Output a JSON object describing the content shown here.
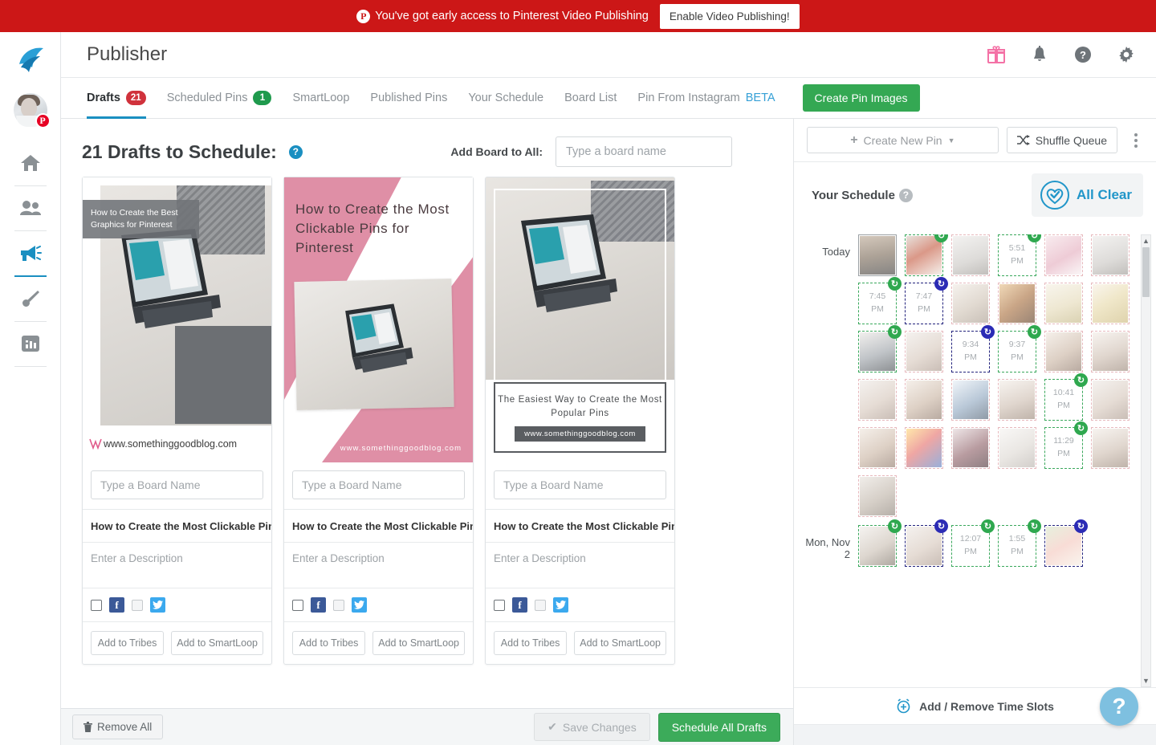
{
  "promo": {
    "icon": "pinterest-icon",
    "message": "You've got early access to Pinterest Video Publishing",
    "button_label": "Enable Video Publishing!",
    "background": "#cc1717"
  },
  "sidebar": {
    "logo": "tailwind-logo",
    "avatar": {
      "name": "user-avatar",
      "badge": "P"
    },
    "items": [
      {
        "name": "home-icon",
        "active": false
      },
      {
        "name": "tribes-people-icon",
        "active": false
      },
      {
        "name": "megaphone-publisher-icon",
        "active": true
      },
      {
        "name": "brush-create-icon",
        "active": false
      },
      {
        "name": "analytics-chart-icon",
        "active": false
      }
    ]
  },
  "header": {
    "title": "Publisher",
    "icons": [
      {
        "name": "gift-icon",
        "color": "#f472a6"
      },
      {
        "name": "bell-icon",
        "color": "#6e7479"
      },
      {
        "name": "help-circle-icon",
        "color": "#6e7479"
      },
      {
        "name": "gear-icon",
        "color": "#6e7479"
      }
    ]
  },
  "tabs": {
    "items": [
      {
        "label": "Drafts",
        "count": "21",
        "count_color": "#d0323c",
        "active": true
      },
      {
        "label": "Scheduled Pins",
        "count": "1",
        "count_color": "#1f9a4d",
        "active": false
      },
      {
        "label": "SmartLoop",
        "active": false
      },
      {
        "label": "Published Pins",
        "active": false
      },
      {
        "label": "Your Schedule",
        "active": false
      },
      {
        "label": "Board List",
        "active": false
      },
      {
        "label": "Pin From Instagram",
        "suffix": "BETA",
        "active": false
      }
    ],
    "cta_label": "Create Pin Images",
    "cta_color": "#34a853"
  },
  "drafts": {
    "heading": "21 Drafts to Schedule:",
    "heading_help": "?",
    "add_board_label": "Add Board to All:",
    "add_board_placeholder": "Type a board name",
    "add_board_value": "",
    "cards": [
      {
        "art": "pin1",
        "overlay_text": "How to Create the Best Graphics for Pinterest",
        "url_text": "www.somethinggoodblog.com",
        "board_placeholder": "Type a Board Name",
        "board_value": "",
        "title": "How to Create the Most Clickable Pins",
        "description_placeholder": "Enter a Description",
        "description_value": "",
        "facebook_checked": false,
        "twitter_checked": false,
        "tribes_label": "Add to Tribes",
        "smartloop_label": "Add to SmartLoop"
      },
      {
        "art": "pin2",
        "overlay_text": "How to Create the Most Clickable Pins for Pinterest",
        "url_text": "www.somethinggoodblog.com",
        "board_placeholder": "Type a Board Name",
        "board_value": "",
        "title": "How to Create the Most Clickable Pins",
        "description_placeholder": "Enter a Description",
        "description_value": "",
        "facebook_checked": false,
        "twitter_checked": false,
        "tribes_label": "Add to Tribes",
        "smartloop_label": "Add to SmartLoop"
      },
      {
        "art": "pin3",
        "overlay_text": "The Easiest Way to Create the Most Popular Pins",
        "url_text": "www.somethinggoodblog.com",
        "board_placeholder": "Type a Board Name",
        "board_value": "",
        "title": "How to Create the Most Clickable Pins",
        "description_placeholder": "Enter a Description",
        "description_value": "",
        "facebook_checked": false,
        "twitter_checked": false,
        "tribes_label": "Add to Tribes",
        "smartloop_label": "Add to SmartLoop"
      }
    ]
  },
  "bottom_bar": {
    "remove_all_label": "Remove All",
    "remove_all_icon": "trash-icon",
    "save_changes_label": "Save Changes",
    "save_changes_icon": "check-icon",
    "schedule_all_label": "Schedule All Drafts",
    "schedule_all_color": "#3cab5a"
  },
  "schedule": {
    "create_new_pin_label": "Create New Pin",
    "shuffle_queue_label": "Shuffle Queue",
    "kebab": "more-options-icon",
    "title": "Your Schedule",
    "title_help": "?",
    "all_clear_label": "All Clear",
    "all_clear_icon": "heart-check-icon",
    "add_remove_label": "Add / Remove Time Slots",
    "add_remove_icon": "alarm-plus-icon",
    "help_fab": "?",
    "days": [
      {
        "label": "Today",
        "slots": [
          {
            "style": "solid",
            "thumb": "t-a",
            "recycle": null,
            "time": ""
          },
          {
            "style": "dash-green",
            "thumb": "t-b",
            "recycle": "green",
            "time": ""
          },
          {
            "style": "dash-pink",
            "thumb": "t-c",
            "recycle": null,
            "time": ""
          },
          {
            "style": "dash-green",
            "thumb": null,
            "recycle": "green",
            "time": "5:51 PM"
          },
          {
            "style": "dash-pink",
            "thumb": "t-d",
            "recycle": null,
            "time": ""
          },
          {
            "style": "dash-pink",
            "thumb": "t-c",
            "recycle": null,
            "time": ""
          },
          {
            "style": "dash-green",
            "thumb": null,
            "recycle": "green",
            "time": "7:45 PM"
          },
          {
            "style": "dash-blue",
            "thumb": null,
            "recycle": "blue",
            "time": "7:47 PM"
          },
          {
            "style": "dash-pink",
            "thumb": "t-e",
            "recycle": null,
            "time": ""
          },
          {
            "style": "dash-pink",
            "thumb": "t-f",
            "recycle": null,
            "time": ""
          },
          {
            "style": "dash-pink",
            "thumb": "t-g",
            "recycle": null,
            "time": ""
          },
          {
            "style": "dash-pink",
            "thumb": "t-h",
            "recycle": null,
            "time": ""
          },
          {
            "style": "dash-green",
            "thumb": "t-i",
            "recycle": "green",
            "time": ""
          },
          {
            "style": "dash-pink",
            "thumb": "t-j",
            "recycle": null,
            "time": ""
          },
          {
            "style": "dash-blue",
            "thumb": null,
            "recycle": "blue",
            "time": "9:34 PM"
          },
          {
            "style": "dash-green",
            "thumb": null,
            "recycle": "green",
            "time": "9:37 PM"
          },
          {
            "style": "dash-pink",
            "thumb": "t-k",
            "recycle": null,
            "time": ""
          },
          {
            "style": "dash-pink",
            "thumb": "t-l",
            "recycle": null,
            "time": ""
          },
          {
            "style": "dash-pink",
            "thumb": "t-j",
            "recycle": null,
            "time": ""
          },
          {
            "style": "dash-pink",
            "thumb": "t-k",
            "recycle": null,
            "time": ""
          },
          {
            "style": "dash-pink",
            "thumb": "t-m",
            "recycle": null,
            "time": ""
          },
          {
            "style": "dash-pink",
            "thumb": "t-l",
            "recycle": null,
            "time": ""
          },
          {
            "style": "dash-green",
            "thumb": null,
            "recycle": "green",
            "time": "10:41 PM"
          },
          {
            "style": "dash-pink",
            "thumb": "t-j",
            "recycle": null,
            "time": ""
          },
          {
            "style": "dash-pink",
            "thumb": "t-k",
            "recycle": null,
            "time": ""
          },
          {
            "style": "dash-pink",
            "thumb": "t-o",
            "recycle": null,
            "time": ""
          },
          {
            "style": "dash-pink",
            "thumb": "t-p",
            "recycle": null,
            "time": ""
          },
          {
            "style": "dash-pink",
            "thumb": "t-q",
            "recycle": null,
            "time": ""
          },
          {
            "style": "dash-green",
            "thumb": null,
            "recycle": "green",
            "time": "11:29 PM"
          },
          {
            "style": "dash-pink",
            "thumb": "t-l",
            "recycle": null,
            "time": ""
          },
          {
            "style": "dash-pink",
            "thumb": "t-r",
            "recycle": null,
            "time": ""
          }
        ]
      },
      {
        "label": "Mon, Nov 2",
        "slots": [
          {
            "style": "dash-green",
            "thumb": "t-s",
            "recycle": "green",
            "time": ""
          },
          {
            "style": "dash-blue",
            "thumb": "t-j",
            "recycle": "blue",
            "time": ""
          },
          {
            "style": "dash-green",
            "thumb": null,
            "recycle": "green",
            "time": "12:07 PM"
          },
          {
            "style": "dash-green",
            "thumb": null,
            "recycle": "green",
            "time": "1:55 PM"
          },
          {
            "style": "dash-blue",
            "thumb": "t-t",
            "recycle": "blue",
            "time": ""
          }
        ]
      }
    ]
  }
}
